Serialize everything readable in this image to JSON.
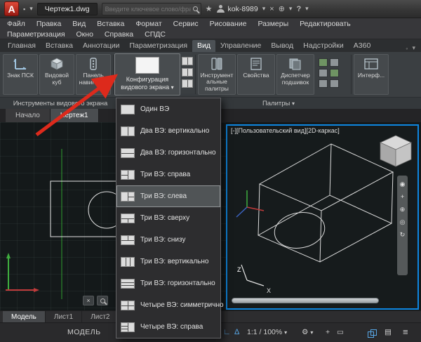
{
  "titlebar": {
    "logo": "A",
    "doc_title": "Чертеж1.dwg",
    "search_placeholder": "Введите ключевое слово/фразу",
    "user": "kok-8989"
  },
  "menubar": {
    "row1": [
      "Файл",
      "Правка",
      "Вид",
      "Вставка",
      "Формат",
      "Сервис",
      "Рисование",
      "Размеры",
      "Редактировать"
    ],
    "row2": [
      "Параметризация",
      "Окно",
      "Справка",
      "СПДС"
    ]
  },
  "ribbon": {
    "tabs": [
      "Главная",
      "Вставка",
      "Аннотации",
      "Параметризация",
      "Вид",
      "Управление",
      "Вывод",
      "Надстройки",
      "A360"
    ],
    "active_tab": "Вид",
    "group1": {
      "ucs": "Знак ПСК",
      "cube": "Видовой куб",
      "nav": "Панель навигации"
    },
    "config_button": {
      "line1": "Конфигурация",
      "line2": "видового экрана"
    },
    "group3": {
      "palettes": "Инструментальные палитры",
      "properties": "Свойства",
      "sheets": "Диспетчер подшивок",
      "interface": "Интерф..."
    },
    "panel_labels": {
      "left": "Инструменты видового экрана",
      "palettes": "Палитры"
    }
  },
  "dropdown": {
    "selected": "Три ВЭ: слева",
    "items": [
      {
        "label": "Один ВЭ",
        "icon": "vp-single"
      },
      {
        "label": "Два ВЭ: вертикально",
        "icon": "vp-two-vertical"
      },
      {
        "label": "Два ВЭ: горизонтально",
        "icon": "vp-two-horizontal"
      },
      {
        "label": "Три ВЭ: справа",
        "icon": "vp-three-right"
      },
      {
        "label": "Три ВЭ: слева",
        "icon": "vp-three-left"
      },
      {
        "label": "Три ВЭ: сверху",
        "icon": "vp-three-above"
      },
      {
        "label": "Три ВЭ: снизу",
        "icon": "vp-three-below"
      },
      {
        "label": "Три ВЭ: вертикально",
        "icon": "vp-three-vertical"
      },
      {
        "label": "Три ВЭ: горизонтально",
        "icon": "vp-three-horizontal"
      },
      {
        "label": "Четыре ВЭ: симметрично",
        "icon": "vp-four-equal"
      },
      {
        "label": "Четыре ВЭ: справа",
        "icon": "vp-four-right"
      }
    ]
  },
  "file_tabs": [
    "Начало",
    "Чертеж1"
  ],
  "viewport": {
    "header": "[-][Пользовательский вид][2D-каркас]",
    "axis_z": "Z",
    "axis_x": "X"
  },
  "layout_tabs": [
    "Модель",
    "Лист1",
    "Лист2"
  ],
  "statusbar": {
    "model": "МОДЕЛЬ",
    "scale": "1:1 / 100%"
  },
  "colors": {
    "active_viewport_border": "#0e86e0",
    "annotation_arrow": "#dd2a1c",
    "ribbon_bg": "#3b3f42",
    "canvas_bg": "#14191a"
  }
}
